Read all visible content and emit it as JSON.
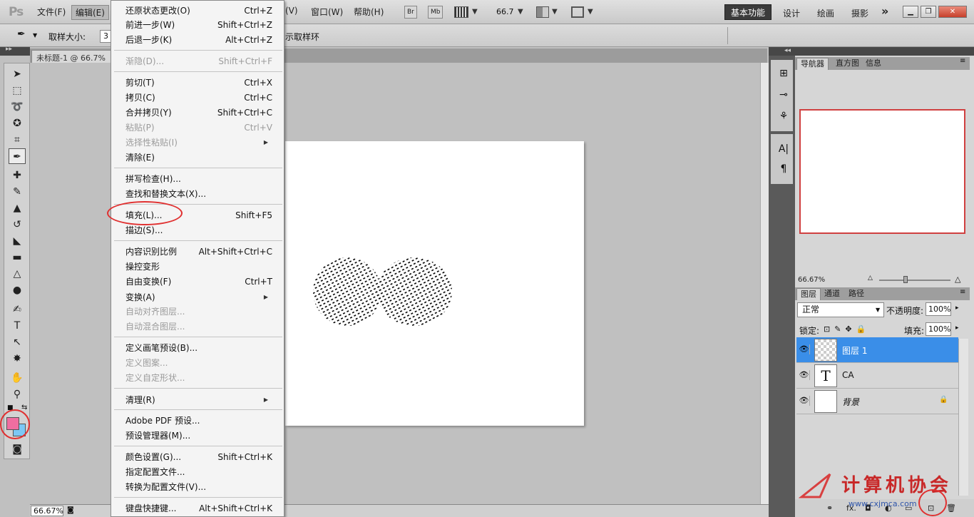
{
  "app": {
    "logo": "Ps"
  },
  "menubar": {
    "items": [
      "文件(F)",
      "编辑(E)",
      "(V)",
      "窗口(W)",
      "帮助(H)"
    ],
    "bridge": "Br",
    "minibridge": "Mb",
    "zoom": "66.7",
    "workspaces": [
      "基本功能",
      "设计",
      "绘画",
      "摄影"
    ],
    "more": "»"
  },
  "options": {
    "sample_size_label": "取样大小:",
    "sample_size_value": "3",
    "sample_ring": "示取样环"
  },
  "document": {
    "tab_title": "未标题-1 @ 66.7%",
    "zoom_status": "66.67%"
  },
  "edit_menu": {
    "groups": [
      [
        {
          "label": "还原状态更改(O)",
          "shortcut": "Ctrl+Z"
        },
        {
          "label": "前进一步(W)",
          "shortcut": "Shift+Ctrl+Z"
        },
        {
          "label": "后退一步(K)",
          "shortcut": "Alt+Ctrl+Z"
        }
      ],
      [
        {
          "label": "渐隐(D)...",
          "shortcut": "Shift+Ctrl+F",
          "disabled": true
        }
      ],
      [
        {
          "label": "剪切(T)",
          "shortcut": "Ctrl+X"
        },
        {
          "label": "拷贝(C)",
          "shortcut": "Ctrl+C"
        },
        {
          "label": "合并拷贝(Y)",
          "shortcut": "Shift+Ctrl+C"
        },
        {
          "label": "粘贴(P)",
          "shortcut": "Ctrl+V",
          "disabled": true
        },
        {
          "label": "选择性粘贴(I)",
          "shortcut": "",
          "disabled": true,
          "submenu": true
        },
        {
          "label": "清除(E)",
          "shortcut": ""
        }
      ],
      [
        {
          "label": "拼写检查(H)...",
          "shortcut": ""
        },
        {
          "label": "查找和替换文本(X)...",
          "shortcut": ""
        }
      ],
      [
        {
          "label": "填充(L)...",
          "shortcut": "Shift+F5",
          "highlight": true
        },
        {
          "label": "描边(S)...",
          "shortcut": ""
        }
      ],
      [
        {
          "label": "内容识别比例",
          "shortcut": "Alt+Shift+Ctrl+C"
        },
        {
          "label": "操控变形",
          "shortcut": ""
        },
        {
          "label": "自由变换(F)",
          "shortcut": "Ctrl+T"
        },
        {
          "label": "变换(A)",
          "shortcut": "",
          "submenu": true
        },
        {
          "label": "自动对齐图层...",
          "shortcut": "",
          "disabled": true
        },
        {
          "label": "自动混合图层...",
          "shortcut": "",
          "disabled": true
        }
      ],
      [
        {
          "label": "定义画笔预设(B)...",
          "shortcut": ""
        },
        {
          "label": "定义图案...",
          "shortcut": "",
          "disabled": true
        },
        {
          "label": "定义自定形状...",
          "shortcut": "",
          "disabled": true
        }
      ],
      [
        {
          "label": "清理(R)",
          "shortcut": "",
          "submenu": true
        }
      ],
      [
        {
          "label": "Adobe PDF 预设...",
          "shortcut": ""
        },
        {
          "label": "预设管理器(M)...",
          "shortcut": ""
        }
      ],
      [
        {
          "label": "颜色设置(G)...",
          "shortcut": "Shift+Ctrl+K"
        },
        {
          "label": "指定配置文件...",
          "shortcut": ""
        },
        {
          "label": "转换为配置文件(V)...",
          "shortcut": ""
        }
      ],
      [
        {
          "label": "键盘快捷键...",
          "shortcut": "Alt+Shift+Ctrl+K"
        }
      ]
    ]
  },
  "navigator": {
    "tabs": [
      "导航器",
      "直方图",
      "信息"
    ],
    "zoom": "66.67%"
  },
  "layers": {
    "tabs": [
      "图层",
      "通道",
      "路径"
    ],
    "blend_mode": "正常",
    "opacity_label": "不透明度:",
    "opacity": "100%",
    "lock_label": "锁定:",
    "fill_label": "填充:",
    "fill": "100%",
    "items": [
      {
        "name": "图层 1",
        "selected": true
      },
      {
        "name": "CA",
        "thumb": "T"
      },
      {
        "name": "背景"
      }
    ]
  },
  "colors": {
    "foreground": "#f06ea0",
    "background": "#7cc8f5",
    "highlight": "#e03030",
    "selection": "#3a8ee8"
  },
  "watermark": {
    "text": "计算机协会",
    "url": "www.cxjmca.com"
  }
}
